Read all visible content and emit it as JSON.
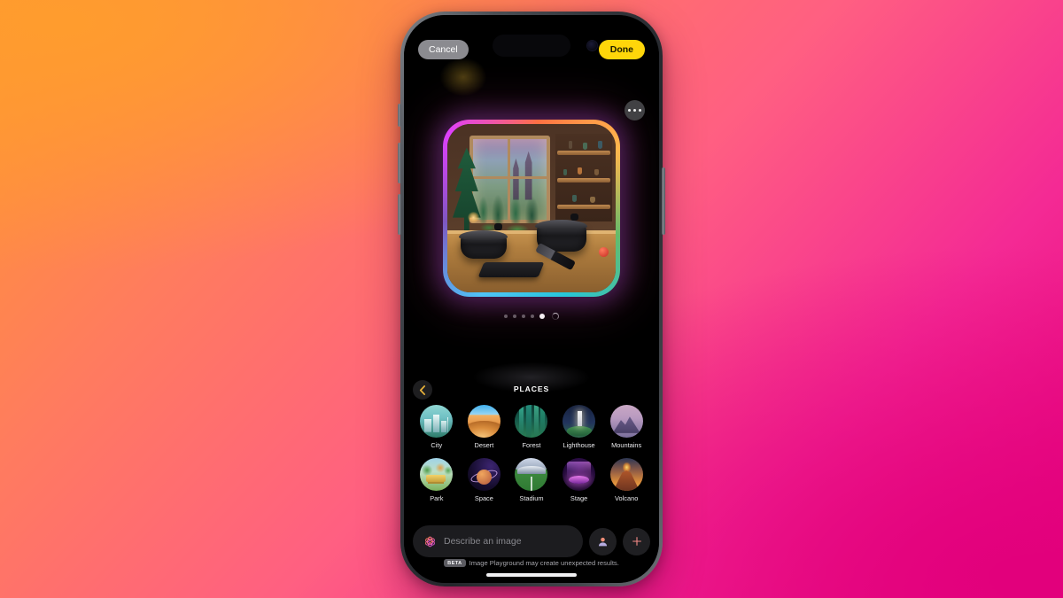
{
  "app": {
    "name": "Image Playground",
    "platform": "iOS"
  },
  "topbar": {
    "cancel_label": "Cancel",
    "done_label": "Done"
  },
  "preview": {
    "more_icon": "ellipsis-icon",
    "image_description": "Generated illustration of a cozy cottage kitchen with two black cooking pots on a wooden counter, a cutting board and rolling pin, a window looking out to pine forest and a distant castle, and shelves of jars",
    "page_dots": {
      "total": 5,
      "active_index": 5,
      "loading": true
    }
  },
  "categories": {
    "back_icon": "chevron-left-icon",
    "title": "PLACES",
    "items": [
      {
        "label": "City",
        "icon": "city-thumbnail",
        "thumb_class": "t-city"
      },
      {
        "label": "Desert",
        "icon": "desert-thumbnail",
        "thumb_class": "t-desert"
      },
      {
        "label": "Forest",
        "icon": "forest-thumbnail",
        "thumb_class": "t-forest"
      },
      {
        "label": "Lighthouse",
        "icon": "lighthouse-thumbnail",
        "thumb_class": "t-lighthouse"
      },
      {
        "label": "Mountains",
        "icon": "mountains-thumbnail",
        "thumb_class": "t-mountains"
      },
      {
        "label": "Park",
        "icon": "park-thumbnail",
        "thumb_class": "t-park"
      },
      {
        "label": "Space",
        "icon": "space-thumbnail",
        "thumb_class": "t-space"
      },
      {
        "label": "Stadium",
        "icon": "stadium-thumbnail",
        "thumb_class": "t-stadium"
      },
      {
        "label": "Stage",
        "icon": "stage-thumbnail",
        "thumb_class": "t-stage"
      },
      {
        "label": "Volcano",
        "icon": "volcano-thumbnail",
        "thumb_class": "t-volcano"
      }
    ]
  },
  "prompt_bar": {
    "ai_icon": "apple-intelligence-icon",
    "placeholder": "Describe an image",
    "value": "",
    "person_button_icon": "person-icon",
    "add_button_icon": "plus-icon"
  },
  "disclaimer": {
    "badge": "BETA",
    "text": "Image Playground may create unexpected results."
  },
  "colors": {
    "done_accent": "#FFD60A",
    "cancel_bg": "#8B8B90",
    "back_chevron": "#E8B23A",
    "screen_bg": "#000000",
    "bg_gradient_start": "#FF9830",
    "bg_gradient_mid": "#FF5F82",
    "bg_gradient_end": "#E6007E"
  }
}
